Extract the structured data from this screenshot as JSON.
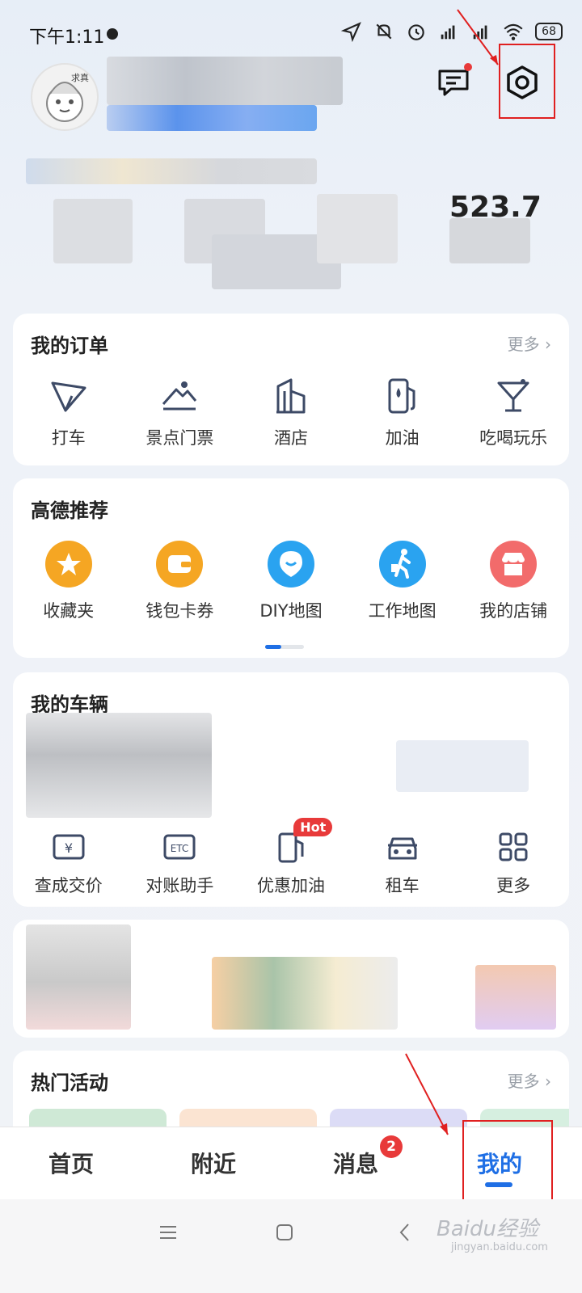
{
  "status_bar": {
    "time": "下午1:11",
    "battery": "68",
    "icons": [
      "location-icon",
      "mute-icon",
      "alarm-icon",
      "signal-hd-icon",
      "signal-hd-icon",
      "wifi-icon",
      "battery-icon"
    ]
  },
  "header": {
    "avatar_badge": "求真",
    "stat_value": "523.7"
  },
  "orders": {
    "title": "我的订单",
    "more": "更多",
    "items": [
      {
        "label": "打车",
        "icon": "taxi-icon"
      },
      {
        "label": "景点门票",
        "icon": "scenic-ticket-icon"
      },
      {
        "label": "酒店",
        "icon": "hotel-icon"
      },
      {
        "label": "加油",
        "icon": "fuel-icon"
      },
      {
        "label": "吃喝玩乐",
        "icon": "cocktail-icon"
      }
    ]
  },
  "recommend": {
    "title": "高德推荐",
    "items": [
      {
        "label": "收藏夹",
        "icon": "star-icon",
        "color": "#f5a623"
      },
      {
        "label": "钱包卡券",
        "icon": "wallet-icon",
        "color": "#f5a623"
      },
      {
        "label": "DIY地图",
        "icon": "diy-map-icon",
        "color": "#2aa3f0"
      },
      {
        "label": "工作地图",
        "icon": "work-map-icon",
        "color": "#2aa3f0"
      },
      {
        "label": "我的店铺",
        "icon": "shop-icon",
        "color": "#f26b6b"
      }
    ]
  },
  "vehicle": {
    "title": "我的车辆",
    "items": [
      {
        "label": "查成交价",
        "icon": "price-icon"
      },
      {
        "label": "对账助手",
        "icon": "etc-icon"
      },
      {
        "label": "优惠加油",
        "icon": "fuel-icon",
        "badge": "Hot"
      },
      {
        "label": "租车",
        "icon": "car-icon"
      },
      {
        "label": "更多",
        "icon": "grid-icon"
      }
    ]
  },
  "activities": {
    "title": "热门活动",
    "more": "更多"
  },
  "tabbar": {
    "tabs": [
      {
        "label": "首页"
      },
      {
        "label": "附近"
      },
      {
        "label": "消息",
        "badge": "2"
      },
      {
        "label": "我的",
        "active": true
      }
    ]
  },
  "watermark": "Baidu经验",
  "watermark_url": "jingyan.baidu.com",
  "colors": {
    "accent": "#1f6fe5",
    "badge": "#e83a3a",
    "annotation": "#e02020"
  }
}
